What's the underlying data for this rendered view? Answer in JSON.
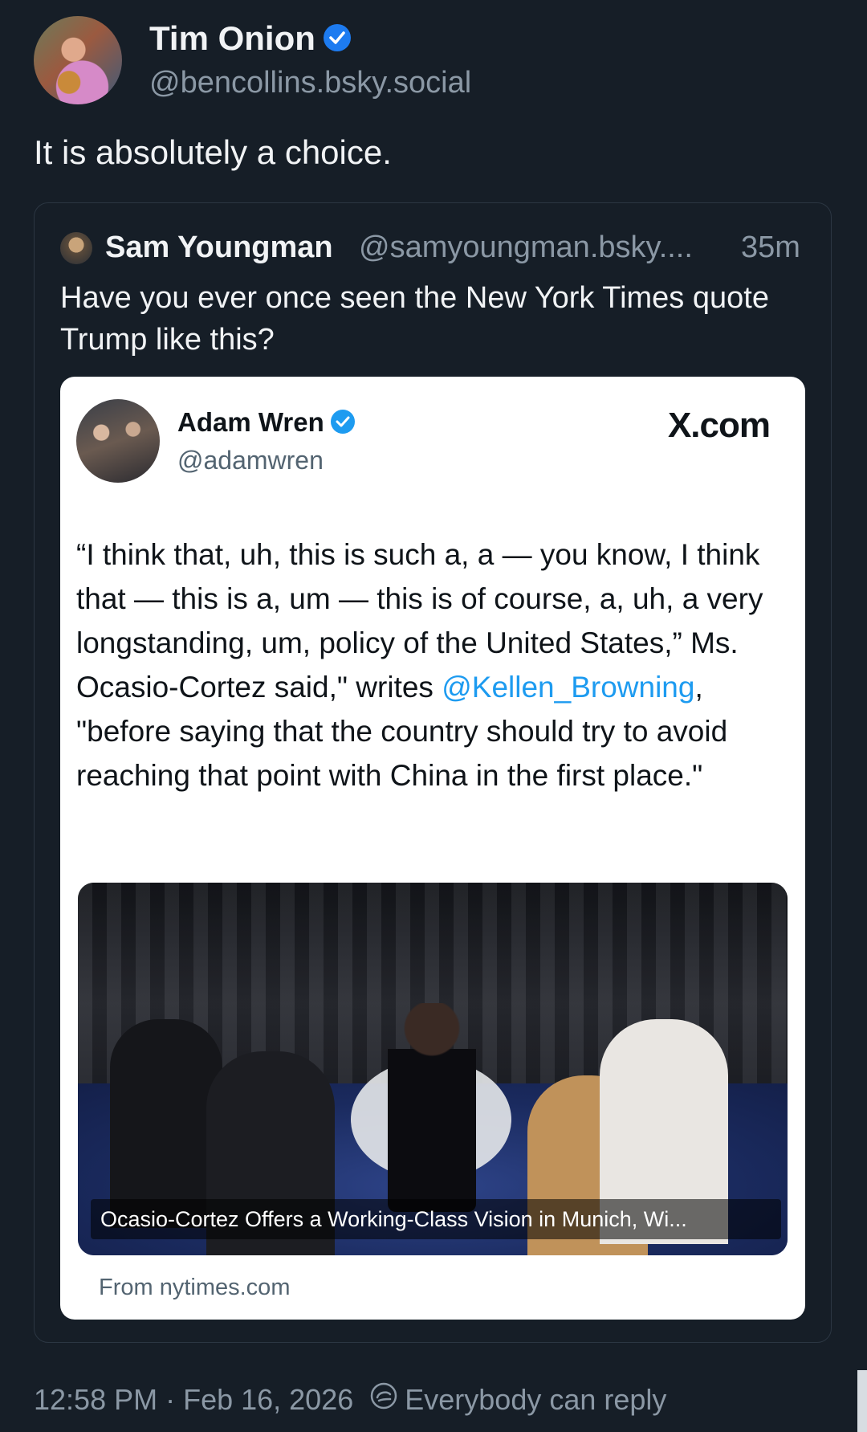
{
  "post": {
    "author_name": "Tim Onion",
    "author_handle": "@bencollins.bsky.social",
    "text": "It is absolutely a choice.",
    "timestamp": "12:58 PM · Feb 16, 2026",
    "reply_setting": "Everybody can reply"
  },
  "quote": {
    "author_name": "Sam Youngman",
    "author_handle": "@samyoungman.bsky....",
    "time_ago": "35m",
    "text": "Have you ever once seen the New York Times quote Trump like this?"
  },
  "embed": {
    "author_name": "Adam Wren",
    "author_handle": "@adamwren",
    "site": "X.com",
    "text_part1": "“I think that, uh, this is such a, a — you know, I think that — this is a, um — this is of course, a, uh, a very longstanding, um, policy of the United States,” Ms. Ocasio-Cortez said,\" writes ",
    "mention": "@Kellen_Browning",
    "text_part2": ", \"before saying that the country should try to avoid reaching that point with China in the first place.\"",
    "link_caption": "Ocasio-Cortez Offers a Working-Class Vision in Munich, Wi...",
    "source": "From nytimes.com"
  },
  "colors": {
    "background": "#161e27",
    "verified": "#1d7bf0",
    "mention": "#1d9bf0",
    "muted_text": "#8b98a5"
  },
  "icons": [
    "verified-badge-icon",
    "reply-settings-icon"
  ]
}
